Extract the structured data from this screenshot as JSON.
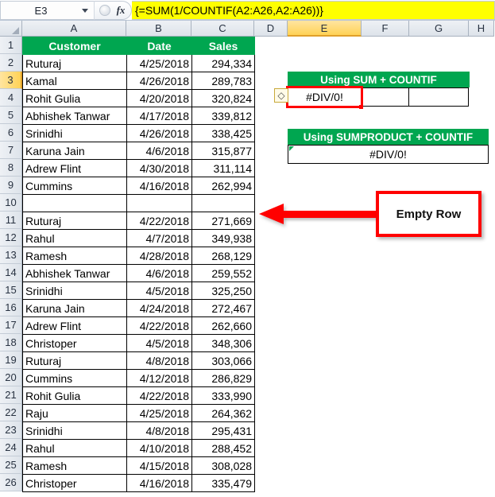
{
  "app": "excel-spreadsheet",
  "formula_bar": {
    "name_box_value": "E3",
    "fx_label": "fx",
    "formula": "{=SUM(1/COUNTIF(A2:A26,A2:A26))}"
  },
  "grid": {
    "column_headers": [
      "A",
      "B",
      "C",
      "D",
      "E",
      "F",
      "G",
      "H"
    ],
    "selected_column": "E",
    "selected_row": 3,
    "row_numbers": [
      1,
      2,
      3,
      4,
      5,
      6,
      7,
      8,
      9,
      10,
      11,
      12,
      13,
      14,
      15,
      16,
      17,
      18,
      19,
      20,
      21,
      22,
      23,
      24,
      25,
      26
    ]
  },
  "table": {
    "headers": [
      "Customer",
      "Date",
      "Sales"
    ],
    "rows": [
      {
        "row": 2,
        "customer": "Ruturaj",
        "date": "4/25/2018",
        "sales": "294,334"
      },
      {
        "row": 3,
        "customer": "Kamal",
        "date": "4/26/2018",
        "sales": "289,783"
      },
      {
        "row": 4,
        "customer": "Rohit Gulia",
        "date": "4/20/2018",
        "sales": "320,824"
      },
      {
        "row": 5,
        "customer": "Abhishek Tanwar",
        "date": "4/17/2018",
        "sales": "339,812"
      },
      {
        "row": 6,
        "customer": "Srinidhi",
        "date": "4/26/2018",
        "sales": "338,425"
      },
      {
        "row": 7,
        "customer": "Karuna Jain",
        "date": "4/6/2018",
        "sales": "315,877"
      },
      {
        "row": 8,
        "customer": "Adrew Flint",
        "date": "4/30/2018",
        "sales": "311,114"
      },
      {
        "row": 9,
        "customer": "Cummins",
        "date": "4/16/2018",
        "sales": "262,994"
      },
      {
        "row": 10,
        "customer": "",
        "date": "",
        "sales": ""
      },
      {
        "row": 11,
        "customer": "Ruturaj",
        "date": "4/22/2018",
        "sales": "271,669"
      },
      {
        "row": 12,
        "customer": "Rahul",
        "date": "4/7/2018",
        "sales": "349,938"
      },
      {
        "row": 13,
        "customer": "Ramesh",
        "date": "4/28/2018",
        "sales": "268,129"
      },
      {
        "row": 14,
        "customer": "Abhishek Tanwar",
        "date": "4/6/2018",
        "sales": "259,552"
      },
      {
        "row": 15,
        "customer": "Srinidhi",
        "date": "4/5/2018",
        "sales": "325,250"
      },
      {
        "row": 16,
        "customer": "Karuna Jain",
        "date": "4/24/2018",
        "sales": "272,467"
      },
      {
        "row": 17,
        "customer": "Adrew Flint",
        "date": "4/22/2018",
        "sales": "262,660"
      },
      {
        "row": 18,
        "customer": "Christoper",
        "date": "4/5/2018",
        "sales": "348,306"
      },
      {
        "row": 19,
        "customer": "Ruturaj",
        "date": "4/8/2018",
        "sales": "303,066"
      },
      {
        "row": 20,
        "customer": "Cummins",
        "date": "4/12/2018",
        "sales": "286,829"
      },
      {
        "row": 21,
        "customer": "Rohit Gulia",
        "date": "4/22/2018",
        "sales": "333,990"
      },
      {
        "row": 22,
        "customer": "Raju",
        "date": "4/25/2018",
        "sales": "264,362"
      },
      {
        "row": 23,
        "customer": "Srinidhi",
        "date": "4/8/2018",
        "sales": "295,431"
      },
      {
        "row": 24,
        "customer": "Rahul",
        "date": "4/10/2018",
        "sales": "288,452"
      },
      {
        "row": 25,
        "customer": "Ramesh",
        "date": "4/15/2018",
        "sales": "308,028"
      },
      {
        "row": 26,
        "customer": "Christoper",
        "date": "4/16/2018",
        "sales": "335,479"
      }
    ]
  },
  "results": {
    "sum_countif": {
      "title": "Using SUM + COUNTIF",
      "value": "#DIV/0!"
    },
    "sumproduct_countif": {
      "title": "Using SUMPRODUCT + COUNTIF",
      "value": "#DIV/0!"
    },
    "smart_tag_glyph": "◇"
  },
  "callout": {
    "label": "Empty Row"
  },
  "colors": {
    "header_green": "#00a650",
    "formula_highlight": "#ffff00",
    "selection_red": "#ff0000",
    "selected_header": "#ffd256"
  }
}
